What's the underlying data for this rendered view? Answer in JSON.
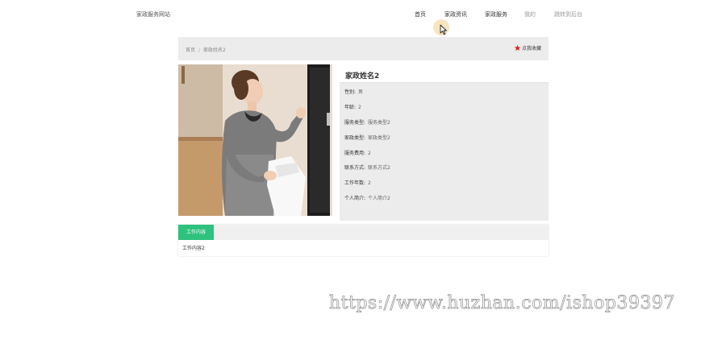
{
  "header": {
    "site_name": "家政服务网站",
    "nav": [
      {
        "label": "首页"
      },
      {
        "label": "家政资讯"
      },
      {
        "label": "家政服务"
      },
      {
        "label": "我的"
      },
      {
        "label": "跳转到后台"
      }
    ]
  },
  "breadcrumb": {
    "home": "首页",
    "separator": "/",
    "current": "家政姓名2"
  },
  "favorite": {
    "label": "点我收藏",
    "icon": "star-icon",
    "color": "#e01515"
  },
  "detail": {
    "title": "家政姓名2",
    "fields": [
      {
        "key": "性别:",
        "value": "男"
      },
      {
        "key": "年龄:",
        "value": "2"
      },
      {
        "key": "服务类型:",
        "value": "服务类型2"
      },
      {
        "key": "家政类型:",
        "value": "家政类型2"
      },
      {
        "key": "服务费用:",
        "value": "2"
      },
      {
        "key": "联系方式:",
        "value": "联系方式2"
      },
      {
        "key": "工作年数:",
        "value": "2"
      },
      {
        "key": "个人简介:",
        "value": "个人简介2"
      }
    ]
  },
  "tabs": [
    {
      "label": "工作内容",
      "active": true,
      "color": "#2ec27e"
    }
  ],
  "tab_content": "工作内容2",
  "watermark": "https://www.huzhan.com/ishop39397"
}
